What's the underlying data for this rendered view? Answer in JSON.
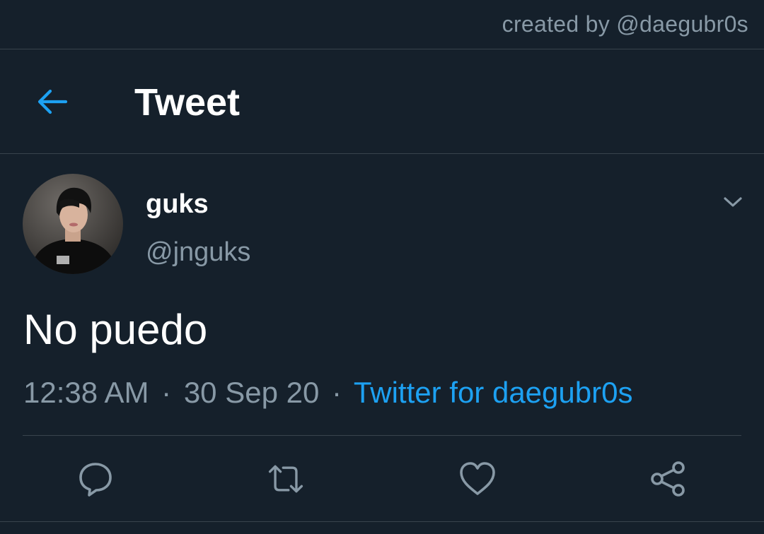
{
  "credit": "created by @daegubr0s",
  "header": {
    "title": "Tweet",
    "back_icon": "arrow-left-icon"
  },
  "tweet": {
    "author": {
      "display_name": "guks",
      "handle": "@jnguks"
    },
    "text": "No puedo",
    "time": "12:38 AM",
    "separator": "·",
    "date": "30 Sep 20",
    "source": "Twitter for daegubr0s"
  },
  "actions": [
    {
      "name": "reply",
      "icon": "reply-icon"
    },
    {
      "name": "retweet",
      "icon": "retweet-icon"
    },
    {
      "name": "like",
      "icon": "heart-icon"
    },
    {
      "name": "share",
      "icon": "share-icon"
    }
  ],
  "colors": {
    "background": "#15202b",
    "accent": "#1da1f2",
    "muted_text": "#8899a6",
    "divider": "#38444d",
    "primary_text": "#ffffff"
  }
}
